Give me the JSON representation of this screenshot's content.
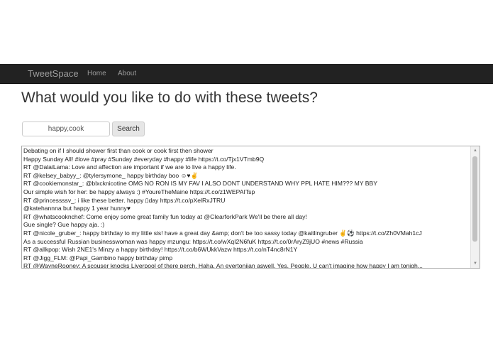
{
  "nav": {
    "brand": "TweetSpace",
    "links": [
      "Home",
      "About"
    ]
  },
  "title": "What would you like to do with these tweets?",
  "search": {
    "value": "happy,cook",
    "button_label": "Search"
  },
  "tweets": [
    "Debating on if I should shower first than cook or cook first then shower",
    "Happy Sunday All! #love #pray #Sunday #everyday #happy #life https://t.co/Tjx1VTmb9Q",
    "RT @DalaiLama: Love and affection are important if we are to live a happy life.",
    "RT @kelsey_babyy_: @tylersymone_ happy birthday boo ☺♥✌",
    "RT @cookiemonstar_: @blxcknicotine OMG NO RON IS MY FAV I ALSO DONT UNDERSTAND WHY PPL HATE HIM??? MY BBY",
    "Our simple wish for her: be happy always :) #YoureTheMaine https://t.co/z1WEPAITsp",
    "RT @princessssv_: i like these better. happy ▯day https://t.co/pXelRxJTRU",
    "@katehannna but happy 1 year hunny♥",
    "RT @whatscooknchef: Come enjoy some great family fun today at @ClearforkPark We'll be there all day!",
    "Gue single? Gue happy aja. :)",
    "RT @nicole_gruber_: happy birthday to my little sis! have a great day &amp; don't be too sassy today @kaitlingruber ✌⚽ https://t.co/Zh0VMah1cJ",
    "As a successful Russian businesswoman was happy mzungu: https://t.co/wXqI2N6fuK https://t.co/0rAryZ9jUO #news #Russia",
    "RT @allkpop: Wish 2NE1's Minzy a happy birthday! https://t.co/b6WUkkVazw https://t.co/nT4nc8rN1Y",
    "RT @Jigg_FLM: @Papi_Gambino happy birthday pimp",
    "RT @WayneRooney: A scouser knocks Liverpool of there perch. Haha. An evertoniian aswell. Yes. People. U can't imagine how happy I am tonigh..."
  ]
}
